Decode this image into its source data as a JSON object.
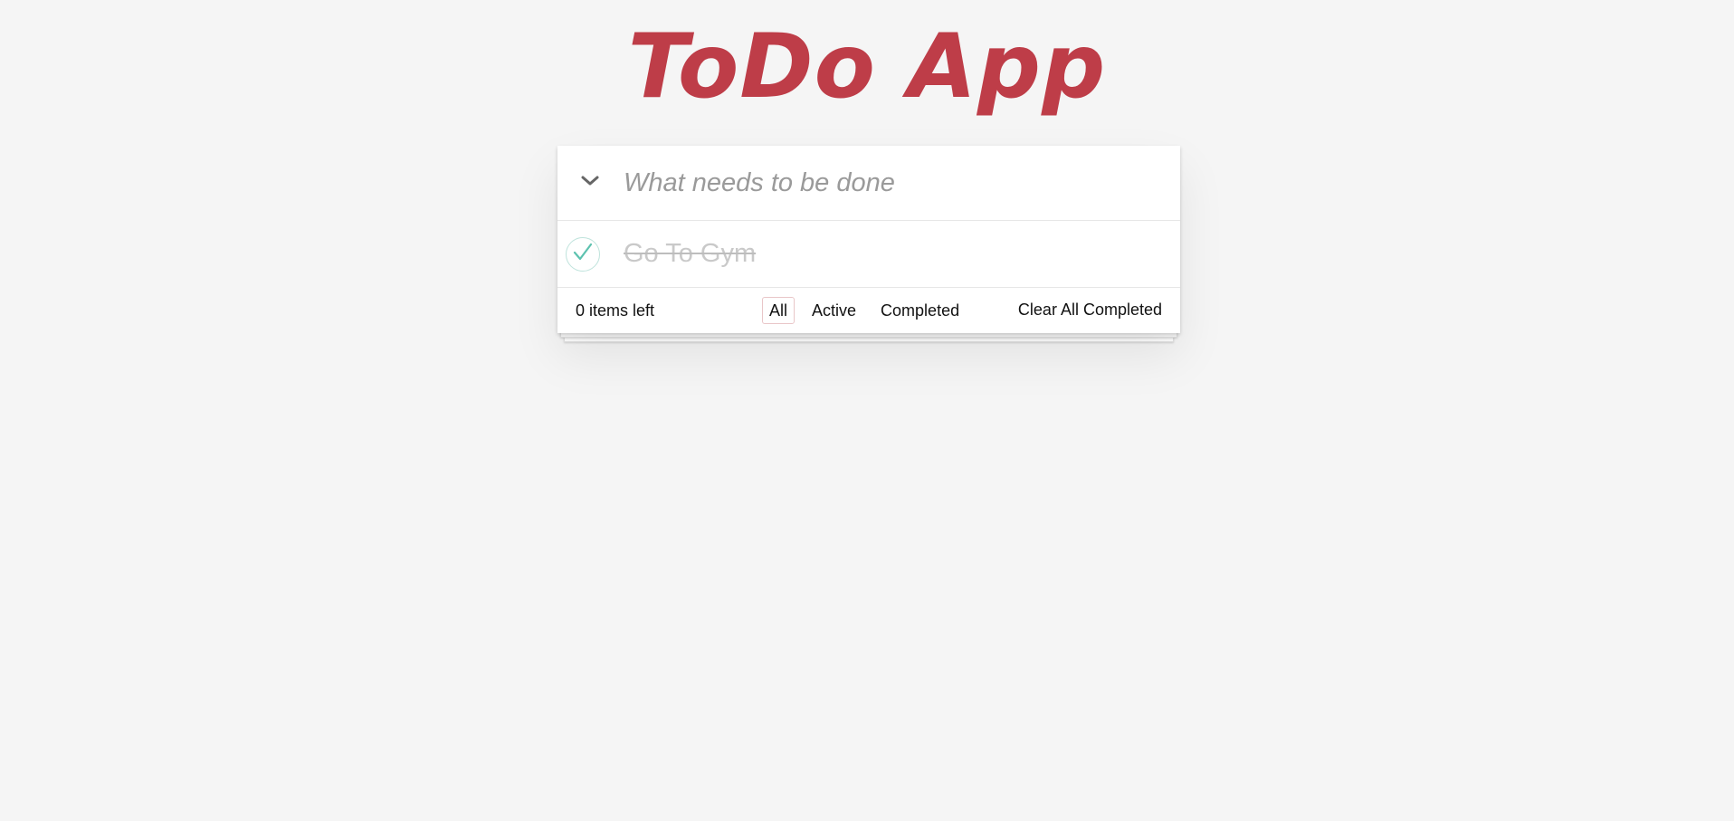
{
  "header": {
    "title": "ToDo App",
    "title_color": "#be3d48"
  },
  "new_todo": {
    "placeholder": "What needs to be done",
    "value": "",
    "toggle_icon": "chevron-down-icon"
  },
  "todos": [
    {
      "label": "Go To Gym",
      "completed": true,
      "check_icon": "checkmark-icon",
      "check_color": "#5dc2af"
    }
  ],
  "footer": {
    "items_left": "0 items left",
    "filters": [
      {
        "label": "All",
        "selected": true
      },
      {
        "label": "Active",
        "selected": false
      },
      {
        "label": "Completed",
        "selected": false
      }
    ],
    "clear_label": "Clear All Completed"
  }
}
